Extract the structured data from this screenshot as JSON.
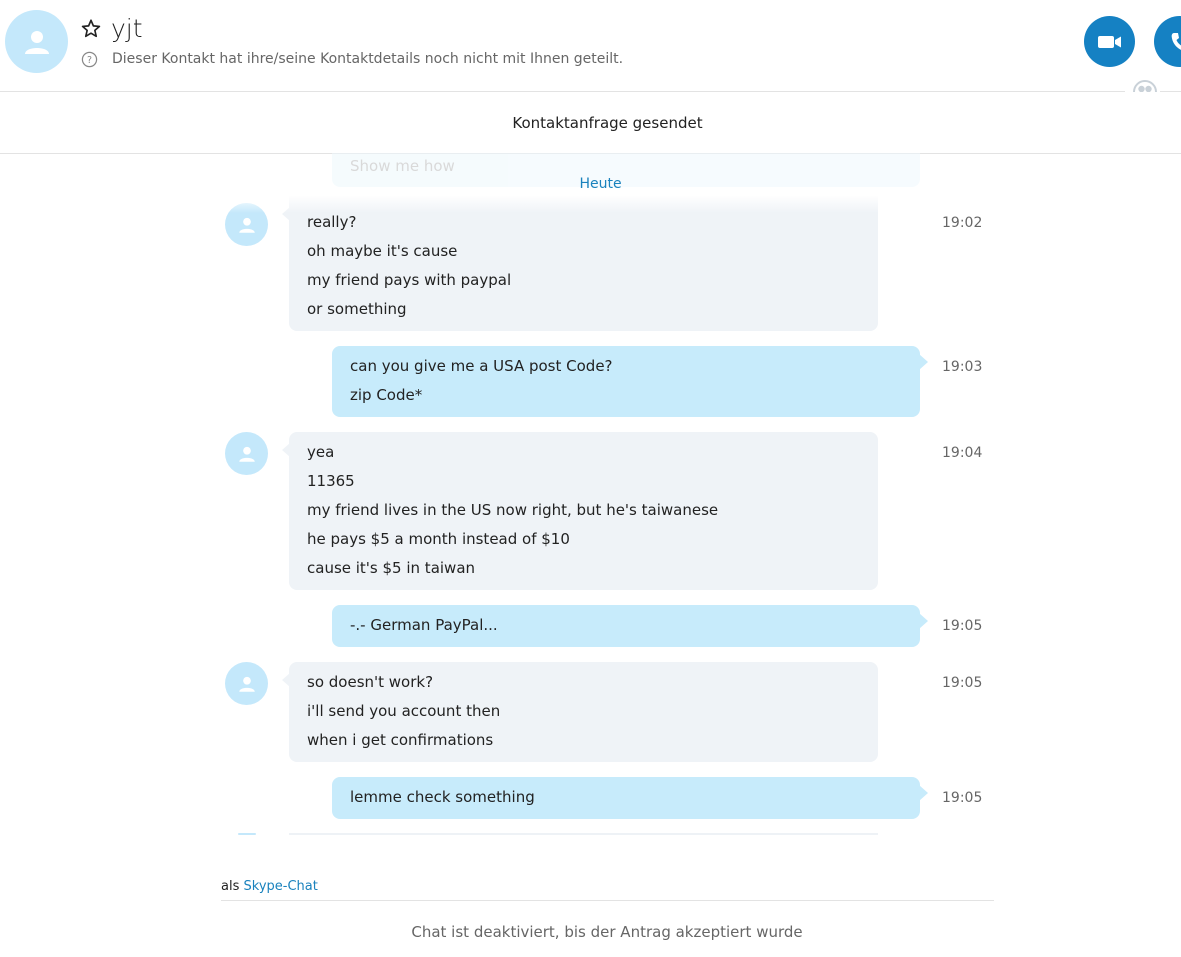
{
  "contact": {
    "name": "yjt",
    "notice": "Dieser Kontakt hat ihre/seine Kontaktdetails noch nicht mit Ihnen geteilt.",
    "icons": [
      "avatar-icon",
      "star-icon",
      "help-icon",
      "video-call-icon",
      "phone-icon",
      "globe-icon"
    ]
  },
  "request_status": "Kontaktanfrage gesendet",
  "conversation": {
    "faded_previous": "Show me how",
    "day_label": "Heute",
    "messages": [
      {
        "from": "contact",
        "time": "19:02",
        "lines": [
          "really?",
          "oh maybe it's cause",
          "my friend pays with paypal",
          "or something"
        ]
      },
      {
        "from": "me",
        "time": "19:03",
        "lines": [
          "can you give me a USA post Code?",
          "zip Code*"
        ]
      },
      {
        "from": "contact",
        "time": "19:04",
        "lines": [
          "yea",
          "11365",
          "my friend lives in the US now right, but he's taiwanese",
          "he pays $5 a month instead of $10",
          "cause it's $5 in taiwan"
        ]
      },
      {
        "from": "me",
        "time": "19:05",
        "lines": [
          "-.- German PayPal..."
        ]
      },
      {
        "from": "contact",
        "time": "19:05",
        "lines": [
          "so doesn't work?",
          "i'll send you account then",
          "when i get confirmations"
        ]
      },
      {
        "from": "me",
        "time": "19:05",
        "lines": [
          "lemme check something"
        ]
      }
    ]
  },
  "footer": {
    "as_prefix": "als",
    "as_link": "Skype-Chat",
    "disabled_note": "Chat ist deaktiviert, bis der Antrag akzeptiert wurde"
  },
  "colors": {
    "accent": "#1581c3",
    "outgoing_bubble": "#c7ebfb",
    "incoming_bubble": "#eff3f7",
    "avatar_bg": "#c4e8fb"
  }
}
